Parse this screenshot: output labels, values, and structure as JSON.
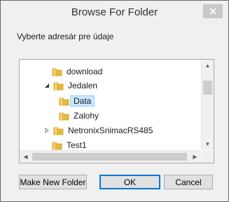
{
  "dialog": {
    "title": "Browse For Folder",
    "close_glyph": "✕",
    "prompt": "Vyberte adresár pre údaje"
  },
  "tree": {
    "items": [
      {
        "label": "download",
        "expander": "none",
        "selected": false
      },
      {
        "label": "Jedalen",
        "expander": "expanded",
        "selected": false
      },
      {
        "label": "Data",
        "expander": "none",
        "selected": true
      },
      {
        "label": "Zalohy",
        "expander": "none",
        "selected": false
      },
      {
        "label": "NetronixSnimacRS485",
        "expander": "collapsed",
        "selected": false
      },
      {
        "label": "Test1",
        "expander": "none",
        "selected": false
      }
    ]
  },
  "buttons": {
    "make_new_folder": "Make New Folder",
    "ok": "OK",
    "cancel": "Cancel"
  },
  "colors": {
    "selection_bg": "#cce8ff",
    "selection_border": "#99d1ff",
    "folder": "#e8b93c",
    "default_button_border": "#0078d7"
  }
}
